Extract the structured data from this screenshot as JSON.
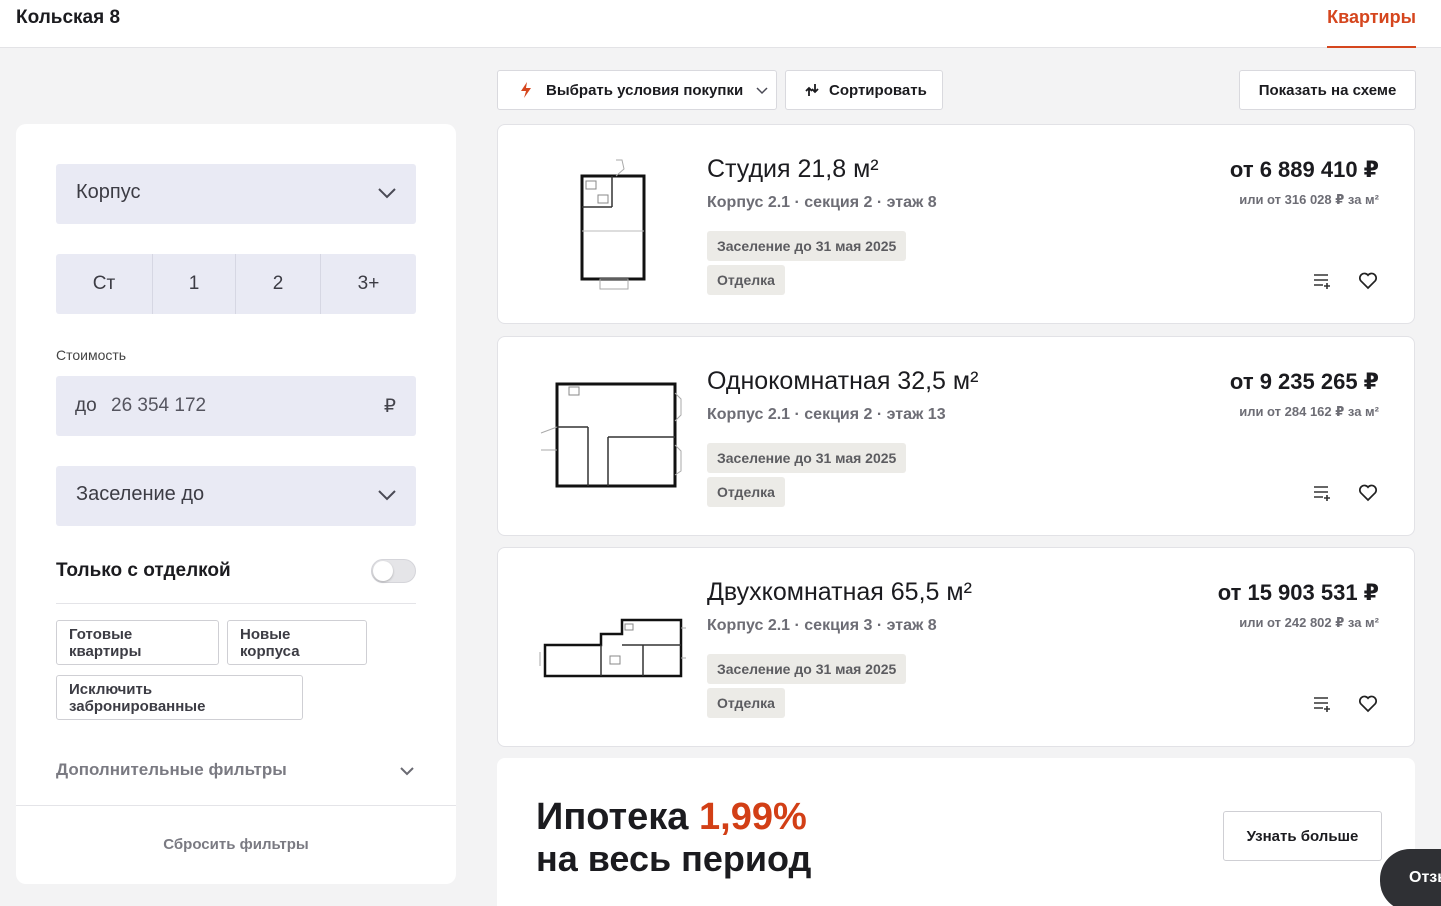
{
  "header": {
    "title": "Кольская 8",
    "nav_link": "Квартиры"
  },
  "filters": {
    "building_select": "Корпус",
    "rooms": [
      "Ст",
      "1",
      "2",
      "3+"
    ],
    "price_label": "Стоимость",
    "price_prefix": "до",
    "price_value": "26 354 172",
    "price_currency": "₽",
    "move_in_select": "Заселение до",
    "finish_only_label": "Только с отделкой",
    "chips": [
      "Готовые квартиры",
      "Новые корпуса",
      "Исключить забронированные"
    ],
    "more_filters": "Дополнительные фильтры",
    "reset": "Сбросить фильтры"
  },
  "toolbar": {
    "purchase_terms": "Выбрать условия покупки",
    "sort": "Сортировать",
    "show_on_plan": "Показать на схеме"
  },
  "listings": [
    {
      "name": "Студия 21,8 м²",
      "meta": "Корпус 2.1 · секция 2 · этаж 8",
      "tags": [
        "Заселение до 31 мая 2025",
        "Отделка"
      ],
      "price": "от 6 889 410 ₽",
      "price_per_m2": "или от 316 028 ₽ за м²"
    },
    {
      "name": "Однокомнатная 32,5 м²",
      "meta": "Корпус 2.1 · секция 2 · этаж 13",
      "tags": [
        "Заселение до 31 мая 2025",
        "Отделка"
      ],
      "price": "от 9 235 265 ₽",
      "price_per_m2": "или от 284 162 ₽ за м²"
    },
    {
      "name": "Двухкомнатная 65,5 м²",
      "meta": "Корпус 2.1 · секция 3 · этаж 8",
      "tags": [
        "Заселение до 31 мая 2025",
        "Отделка"
      ],
      "price": "от 15 903 531 ₽",
      "price_per_m2": "или от 242 802 ₽ за м²"
    }
  ],
  "promo": {
    "line1": "Ипотека",
    "accent": "1,99%",
    "line2": "на весь период",
    "button": "Узнать больше"
  },
  "feedback_tab": "Отзыв",
  "colors": {
    "accent": "#d5461e",
    "input_bg": "#e9eaf4",
    "tag_bg": "#ecebe7",
    "page_bg": "#f3f3f4"
  }
}
